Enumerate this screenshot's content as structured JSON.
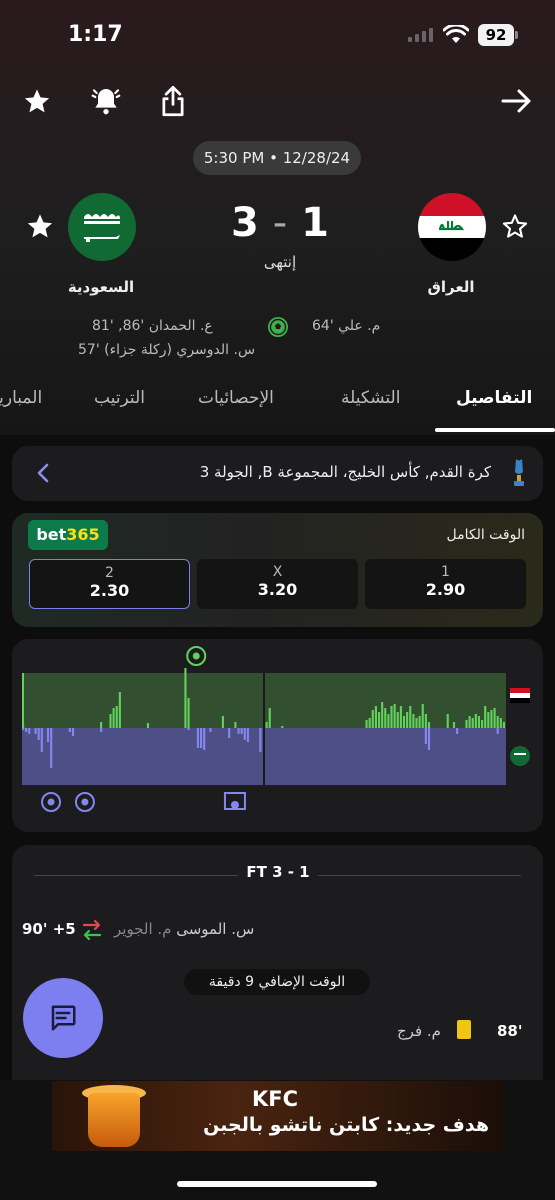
{
  "status_bar": {
    "time": "1:17",
    "battery": "92"
  },
  "match": {
    "datetime": "5:30 PM • 12/28/24",
    "home_team": "العراق",
    "away_team": "السعودية",
    "home_score": "1",
    "away_score": "3",
    "separator": "-",
    "status": "إنتهى",
    "home_scorers": "م. علي '64",
    "away_scorers_line1": "ع. الحمدان '86, '81",
    "away_scorers_line2": "س. الدوسري (ركلة جزاء) '57"
  },
  "tabs": [
    "التفاصيل",
    "التشكيلة",
    "الإحصائيات",
    "الترتيب",
    "المباريات"
  ],
  "league": {
    "text": "كرة القدم, كأس الخليج، المجموعة B, الجولة 3"
  },
  "odds": {
    "brand_prefix": "bet",
    "brand_suffix": "365",
    "title": "الوقت الكامل",
    "options": [
      {
        "label": "2",
        "value": "2.30"
      },
      {
        "label": "X",
        "value": "3.20"
      },
      {
        "label": "1",
        "value": "2.90"
      }
    ]
  },
  "momentum": {
    "home_color": "#62d15b",
    "away_color": "#8387ee",
    "home_values": [
      5,
      0,
      0,
      0,
      0,
      0,
      0,
      0,
      0,
      0,
      0,
      0,
      0,
      0,
      0,
      0,
      0,
      0,
      0,
      0,
      0,
      0,
      0,
      0,
      0,
      6,
      0,
      0,
      14,
      20,
      22,
      36,
      0,
      0,
      0,
      0,
      0,
      0,
      0,
      0,
      5,
      0,
      0,
      0,
      0,
      0,
      0,
      0,
      0,
      0,
      0,
      0,
      60,
      30,
      0,
      0,
      0,
      0,
      0,
      0,
      0,
      0,
      0,
      0,
      12,
      0,
      0,
      0,
      6,
      0,
      0,
      0,
      0,
      0,
      0,
      0,
      0,
      0,
      6,
      20,
      0,
      0,
      0,
      2,
      0,
      0,
      0,
      0,
      0,
      0,
      0,
      0,
      0,
      0,
      0,
      0,
      0,
      0,
      0,
      0,
      0,
      0,
      0,
      0,
      0,
      0,
      0,
      0,
      0,
      0,
      8,
      10,
      18,
      22,
      16,
      26,
      20,
      14,
      22,
      24,
      16,
      22,
      12,
      16,
      22,
      14,
      10,
      12,
      24,
      14,
      6,
      0,
      0,
      0,
      0,
      0,
      14,
      0,
      6,
      0,
      0,
      0,
      8,
      12,
      10,
      14,
      12,
      8,
      22,
      16,
      18,
      20,
      12,
      10,
      6
    ],
    "away_values": [
      2,
      4,
      6,
      0,
      6,
      12,
      24,
      0,
      14,
      40,
      0,
      0,
      0,
      0,
      0,
      4,
      8,
      0,
      0,
      0,
      0,
      0,
      0,
      0,
      0,
      4,
      0,
      0,
      0,
      0,
      0,
      0,
      0,
      0,
      0,
      0,
      0,
      0,
      0,
      0,
      0,
      0,
      0,
      0,
      0,
      0,
      0,
      0,
      0,
      0,
      0,
      0,
      0,
      2,
      0,
      0,
      20,
      20,
      22,
      0,
      4,
      0,
      0,
      0,
      0,
      0,
      10,
      0,
      0,
      6,
      6,
      12,
      14,
      0,
      0,
      0,
      24,
      0,
      0,
      0,
      0,
      0,
      0,
      0,
      0,
      0,
      0,
      0,
      0,
      0,
      0,
      0,
      0,
      0,
      0,
      0,
      0,
      0,
      0,
      0,
      0,
      0,
      0,
      0,
      0,
      0,
      0,
      0,
      0,
      0,
      0,
      0,
      0,
      0,
      0,
      0,
      0,
      0,
      0,
      0,
      0,
      0,
      0,
      0,
      0,
      0,
      0,
      0,
      0,
      16,
      22,
      0,
      0,
      0,
      0,
      0,
      0,
      0,
      0,
      6,
      0,
      0,
      0,
      0,
      0,
      0,
      0,
      0,
      0,
      0,
      0,
      0,
      6,
      0,
      0
    ],
    "halftime_fraction": 0.5,
    "home_goal_fractions": [
      0.36
    ],
    "away_goal_fractions": [
      0.06,
      0.13
    ],
    "away_penalty_fractions": [
      0.44
    ]
  },
  "timeline": {
    "final_label": "FT 3 - 1",
    "events": [
      {
        "minute": "90' +5",
        "text_out": "م. الجوير",
        "text_in": "س. الموسى",
        "type": "substitution"
      },
      {
        "minute": "88'",
        "text": "م. فرج",
        "type": "yellow-card"
      }
    ],
    "added_time": "الوقت الإضافي 9 دقيقة"
  },
  "ad": {
    "brand": "KFC",
    "text": "هدف جديد: كابتن ناتشو بالجبن"
  }
}
